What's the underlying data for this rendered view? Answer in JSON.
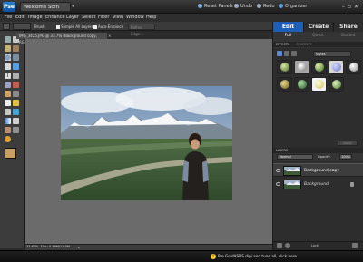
{
  "titlebar": {
    "logo_text": "Pse",
    "welcome_tab": "Welcome Scrn",
    "new_panels": "Reset Panels",
    "undo": "Undo",
    "redo": "Redo",
    "organizer": "Organizer"
  },
  "menubar": {
    "items": [
      "File",
      "Edit",
      "Image",
      "Enhance",
      "Layer",
      "Select",
      "Filter",
      "View",
      "Window",
      "Help"
    ]
  },
  "options_bar": {
    "mode": "Brush",
    "sample_all_layers": "Sample All Layers",
    "auto_enhance": "Auto-Enhance",
    "refine_edge": "Refine Edge..."
  },
  "document": {
    "tab_title": "IMG_3425.JPG @ 33.7% (Background copy, RGB/8) *",
    "status_zoom": "33.67%",
    "status_text": "Doc: 5.49M/11.0M",
    "status_arrow": "▸"
  },
  "right_panel": {
    "mode_tabs": [
      "Edit",
      "Create",
      "Share"
    ],
    "sub_tabs": [
      "Full",
      "Quick",
      "Guided"
    ],
    "effects_header": "EFFECTS",
    "content_header": "CONTENT",
    "effects_category": "Styles",
    "layers_header": "LAYERS",
    "blend_mode": "Normal",
    "opacity_label": "Opacity:",
    "opacity_value": "100%",
    "layers": [
      {
        "name": "Background copy",
        "selected": true
      },
      {
        "name": "Background",
        "selected": false
      }
    ],
    "apply_label": "Apply"
  },
  "footer": {
    "tip": "Pre GoldASUS digi and tune all, click here"
  },
  "colors": {
    "accent_blue": "#2a6fc9",
    "canvas_grey": "#6b6b6b",
    "panel_dark": "#343434"
  }
}
